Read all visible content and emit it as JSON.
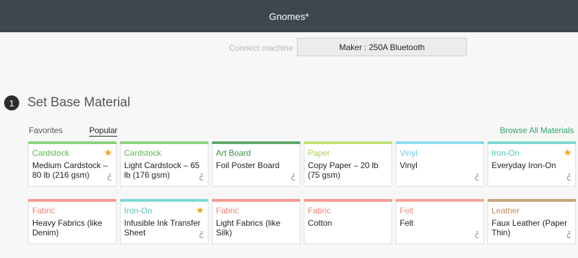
{
  "window": {
    "title": "Gnomes*"
  },
  "machine": {
    "label": "Connect machine",
    "selected": "Maker : 250A Bluetooth"
  },
  "step": {
    "number": "1",
    "title": "Set Base Material"
  },
  "tabs": [
    {
      "label": "Favorites",
      "active": false
    },
    {
      "label": "Popular",
      "active": true
    }
  ],
  "browse_label": "Browse All Materials",
  "colors": {
    "cardstock": "#8bd17b",
    "artboard": "#5fa86a",
    "paper": "#c6e37a",
    "vinyl": "#8fdcef",
    "ironon": "#7fd8d0",
    "fabric": "#f59a8f",
    "felt": "#f2a39a",
    "leather": "#c9a07a",
    "star": "#f2a51a"
  },
  "materials": [
    {
      "category": "Cardstock",
      "name": "Medium Cardstock – 80 lb (216 gsm)",
      "color_key": "cardstock",
      "cat_color": "#55b847",
      "favorite": true,
      "cut_icon": "cut-icon",
      "cut_symbol": "č"
    },
    {
      "category": "Cardstock",
      "name": "Light Cardstock – 65 lb (176 gsm)",
      "color_key": "cardstock",
      "cat_color": "#55b847",
      "favorite": false,
      "cut_icon": "cut-icon",
      "cut_symbol": "č"
    },
    {
      "category": "Art Board",
      "name": "Foil Poster Board",
      "color_key": "artboard",
      "cat_color": "#3f8f4e",
      "favorite": false,
      "cut_icon": "cut-icon",
      "cut_symbol": "č"
    },
    {
      "category": "Paper",
      "name": "Copy Paper – 20 lb (75 gsm)",
      "color_key": "paper",
      "cat_color": "#a9cf52",
      "favorite": false,
      "cut_icon": "",
      "cut_symbol": ""
    },
    {
      "category": "Vinyl",
      "name": "Vinyl",
      "color_key": "vinyl",
      "cat_color": "#6fcbe6",
      "favorite": false,
      "cut_icon": "cut-icon",
      "cut_symbol": "č"
    },
    {
      "category": "Iron-On",
      "name": "Everyday Iron-On",
      "color_key": "ironon",
      "cat_color": "#4fc6ba",
      "favorite": true,
      "cut_icon": "cut-icon",
      "cut_symbol": "č"
    },
    {
      "category": "Fabric",
      "name": "Heavy Fabrics (like Denim)",
      "color_key": "fabric",
      "cat_color": "#f07c6f",
      "favorite": false,
      "cut_icon": "",
      "cut_symbol": ""
    },
    {
      "category": "Iron-On",
      "name": "Infusible Ink Transfer Sheet",
      "color_key": "ironon",
      "cat_color": "#4fc6ba",
      "favorite": true,
      "cut_icon": "cut-icon",
      "cut_symbol": "č"
    },
    {
      "category": "Fabric",
      "name": "Light Fabrics (like Silk)",
      "color_key": "fabric",
      "cat_color": "#f07c6f",
      "favorite": false,
      "cut_icon": "",
      "cut_symbol": ""
    },
    {
      "category": "Fabric",
      "name": "Cotton",
      "color_key": "fabric",
      "cat_color": "#f07c6f",
      "favorite": false,
      "cut_icon": "",
      "cut_symbol": ""
    },
    {
      "category": "Felt",
      "name": "Felt",
      "color_key": "felt",
      "cat_color": "#ef8c80",
      "favorite": false,
      "cut_icon": "cut-icon",
      "cut_symbol": "č"
    },
    {
      "category": "Leather",
      "name": "Faux Leather (Paper Thin)",
      "color_key": "leather",
      "cat_color": "#b58a5e",
      "favorite": false,
      "cut_icon": "cut-icon",
      "cut_symbol": "č"
    }
  ]
}
